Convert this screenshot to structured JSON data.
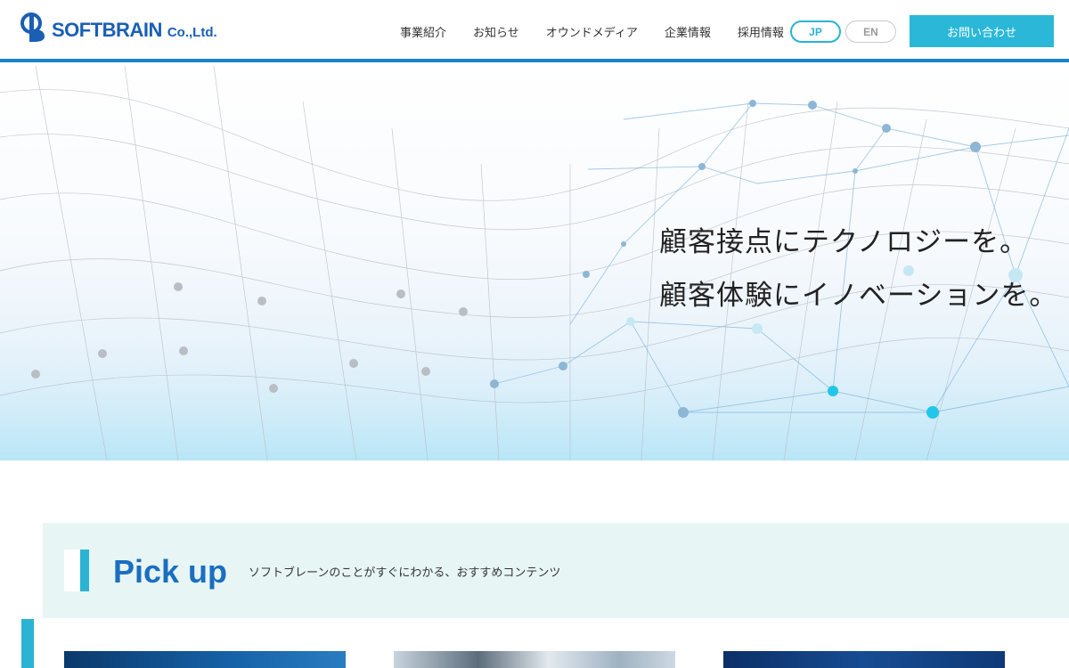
{
  "header": {
    "logo_text": "SOFTBRAIN",
    "logo_suffix": "Co.,Ltd.",
    "nav": [
      {
        "label": "事業紹介"
      },
      {
        "label": "お知らせ"
      },
      {
        "label": "オウンドメディア"
      },
      {
        "label": "企業情報"
      },
      {
        "label": "採用情報"
      }
    ],
    "lang_jp": "JP",
    "lang_en": "EN",
    "contact_label": "お問い合わせ"
  },
  "hero": {
    "line1": "顧客接点にテクノロジーを。",
    "line2": "顧客体験にイノベーションを。"
  },
  "pickup": {
    "title": "Pick up",
    "subtitle": "ソフトブレーンのことがすぐにわかる、おすすめコンテンツ"
  },
  "colors": {
    "brand": "#1a5fb4",
    "accent": "#2bb8d8",
    "header_border": "#1a86c8",
    "pickup_bg": "#e8f5f5"
  }
}
